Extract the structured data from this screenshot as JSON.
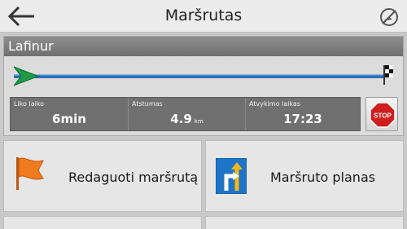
{
  "header": {
    "title": "Maršrutas"
  },
  "route": {
    "name": "Lafinur"
  },
  "info": [
    {
      "label": "Liko laiko",
      "value": "6min",
      "unit": ""
    },
    {
      "label": "Atstumas",
      "value": "4.9",
      "unit": "km"
    },
    {
      "label": "Atvykimo laikas",
      "value": "17:23",
      "unit": ""
    }
  ],
  "stop": {
    "label": "STOP"
  },
  "tiles": {
    "edit_label": "Redaguoti maršrutą",
    "plan_label": "Maršruto planas"
  },
  "colors": {
    "route_line": "#2f6fb1",
    "start_arrow": "#1f9a48",
    "stop_red": "#d01e1e",
    "flag_orange": "#f07a1e"
  }
}
